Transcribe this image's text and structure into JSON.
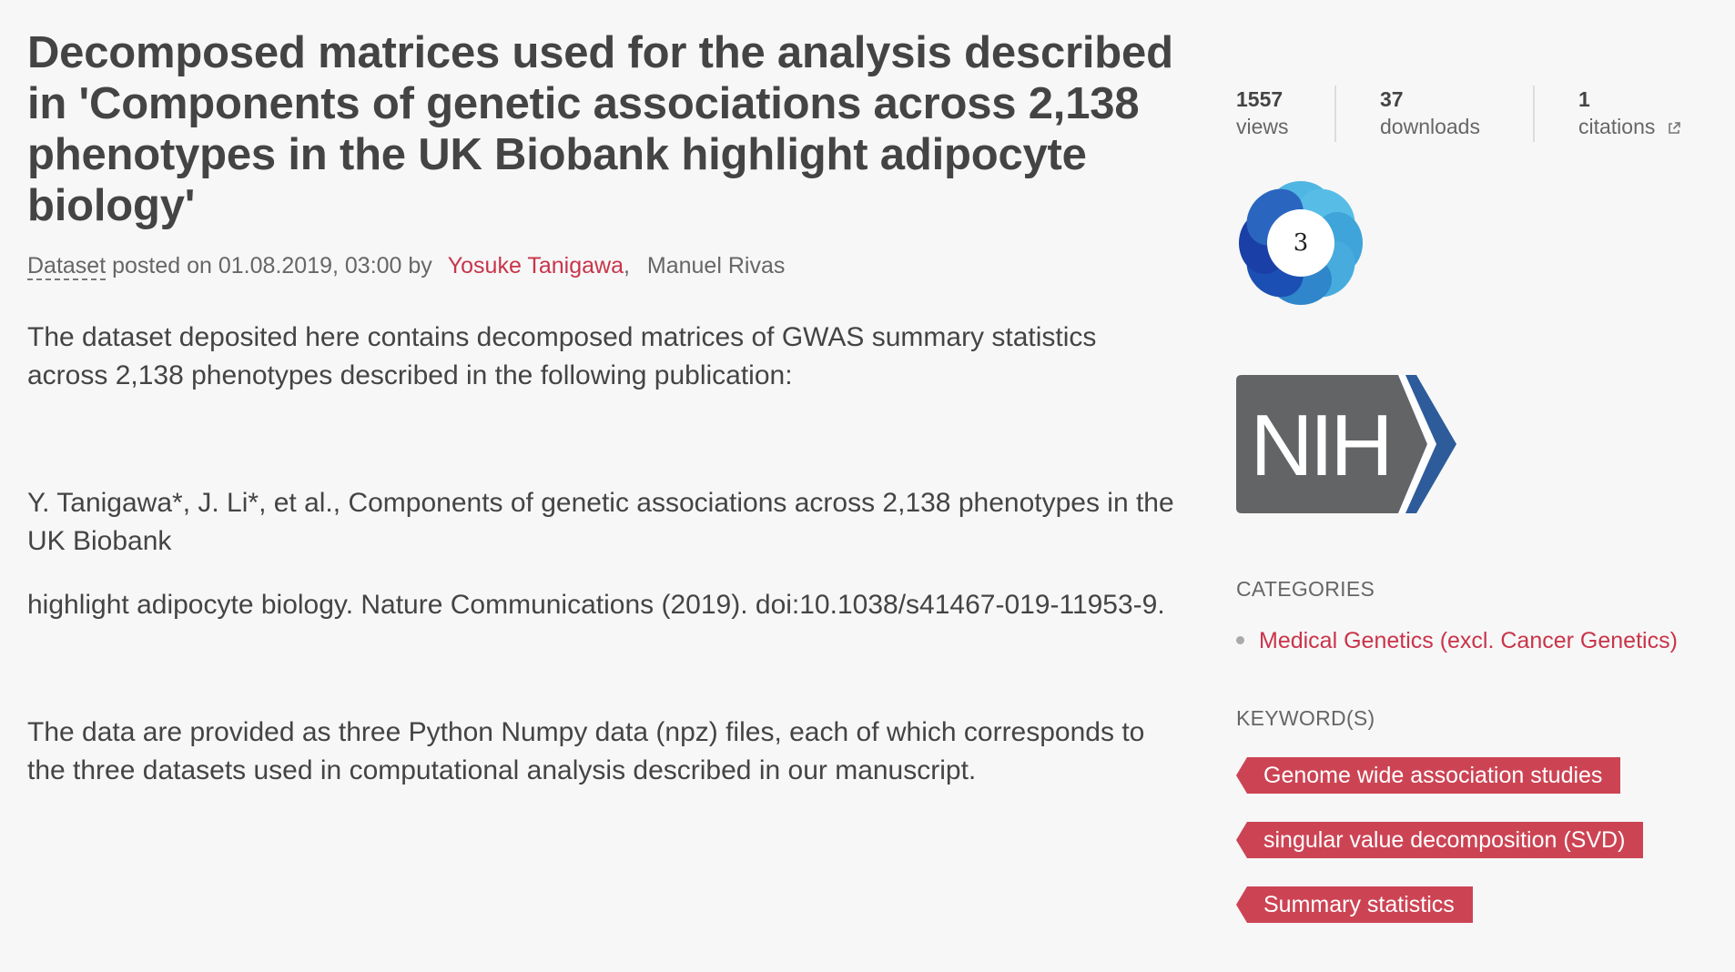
{
  "article": {
    "title": "Decomposed matrices used for the analysis described in 'Components of genetic associations across 2,138 phenotypes in the UK Biobank highlight adipocyte biology'",
    "item_type": "Dataset",
    "posted_text": " posted on 01.08.2019, 03:00 by",
    "authors": [
      {
        "name": "Yosuke Tanigawa",
        "linked": true
      },
      {
        "name": "Manuel Rivas",
        "linked": false
      }
    ],
    "author_separator": ",",
    "description": [
      "The dataset deposited here contains decomposed matrices of GWAS summary statistics across 2,138 phenotypes described in the following publication:",
      "Y. Tanigawa*, J. Li*, et al., Components of genetic associations across 2,138 phenotypes in the UK Biobank",
      "highlight adipocyte biology. Nature Communications (2019). doi:10.1038/s41467-019-11953-9.",
      "The data are provided as three Python Numpy data (npz) files, each of which corresponds to the three datasets used in computational analysis described in our manuscript."
    ]
  },
  "stats": {
    "views": {
      "value": "1557",
      "label": "views"
    },
    "downloads": {
      "value": "37",
      "label": "downloads"
    },
    "citations": {
      "value": "1",
      "label": "citations"
    }
  },
  "altmetric": {
    "score": "3"
  },
  "logo": {
    "text": "NIH",
    "colors": {
      "box": "#636466",
      "chevron": "#2e5c9a"
    }
  },
  "categories": {
    "label": "CATEGORIES",
    "items": [
      "Medical Genetics (excl. Cancer Genetics)"
    ]
  },
  "keywords": {
    "label": "KEYWORD(S)",
    "items": [
      "Genome wide association studies",
      "singular value decomposition (SVD)",
      "Summary statistics"
    ]
  },
  "theme": {
    "accent": "#c9344a",
    "tag_bg": "#cc4454",
    "background": "#f7f7f7"
  }
}
